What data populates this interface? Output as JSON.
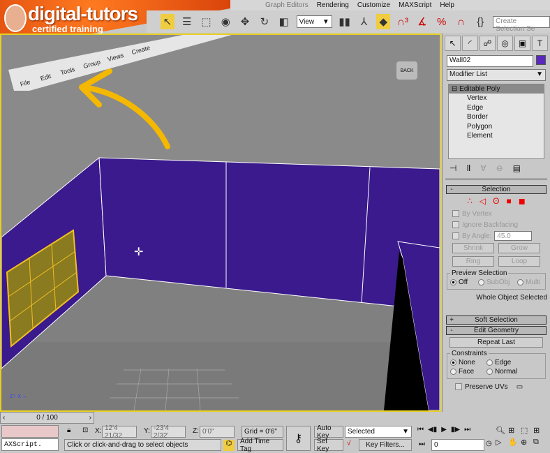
{
  "branding": {
    "logo": "digital-tutors",
    "tagline": "certified training"
  },
  "menu": [
    "Graph Editors",
    "Rendering",
    "Customize",
    "MAXScript",
    "Help"
  ],
  "curled_menu": [
    "File",
    "Edit",
    "Tools",
    "Group",
    "Views",
    "Create"
  ],
  "toolbar": {
    "ref_coord": "View",
    "named_sel_placeholder": "Create Selection Se"
  },
  "viewport": {
    "viewcube_label": "BACK",
    "wall_color": "#3a1a8c",
    "highlight": "#f0c020"
  },
  "panel": {
    "tabs": [
      "create-icon",
      "modify-icon",
      "hierarchy-icon",
      "motion-icon",
      "display-icon",
      "utilities-icon"
    ],
    "object_name": "Wall02",
    "object_color": "#5a28c0",
    "modifier_list": "Modifier List",
    "stack": {
      "root": "Editable Poly",
      "children": [
        "Vertex",
        "Edge",
        "Border",
        "Polygon",
        "Element"
      ]
    },
    "selection": {
      "title": "Selection",
      "by_vertex": "By Vertex",
      "ignore_backfacing": "Ignore Backfacing",
      "by_angle": "By Angle:",
      "angle": "45.0",
      "shrink": "Shrink",
      "grow": "Grow",
      "ring": "Ring",
      "loop": "Loop",
      "preview_title": "Preview Selection",
      "preview_options": [
        "Off",
        "SubObj",
        "Multi"
      ],
      "status": "Whole Object Selected"
    },
    "soft_selection": "Soft Selection",
    "edit_geometry": {
      "title": "Edit Geometry",
      "repeat_last": "Repeat Last",
      "constraints_title": "Constraints",
      "constraints": [
        "None",
        "Edge",
        "Face",
        "Normal"
      ],
      "preserve_uvs": "Preserve UVs"
    }
  },
  "status": {
    "timeline": "0 / 100",
    "maxscript": "AXScript.",
    "x": "12'4 21/32",
    "y": "-23'4 2/32'",
    "z": "0'0\"",
    "grid": "Grid = 0'6\"",
    "prompt": "Click or click-and-drag to select objects",
    "add_time_tag": "Add Time Tag",
    "auto_key": "Auto Key",
    "set_key": "Set Key",
    "key_mode": "Selected",
    "key_filters": "Key Filters...",
    "frame": "0"
  }
}
